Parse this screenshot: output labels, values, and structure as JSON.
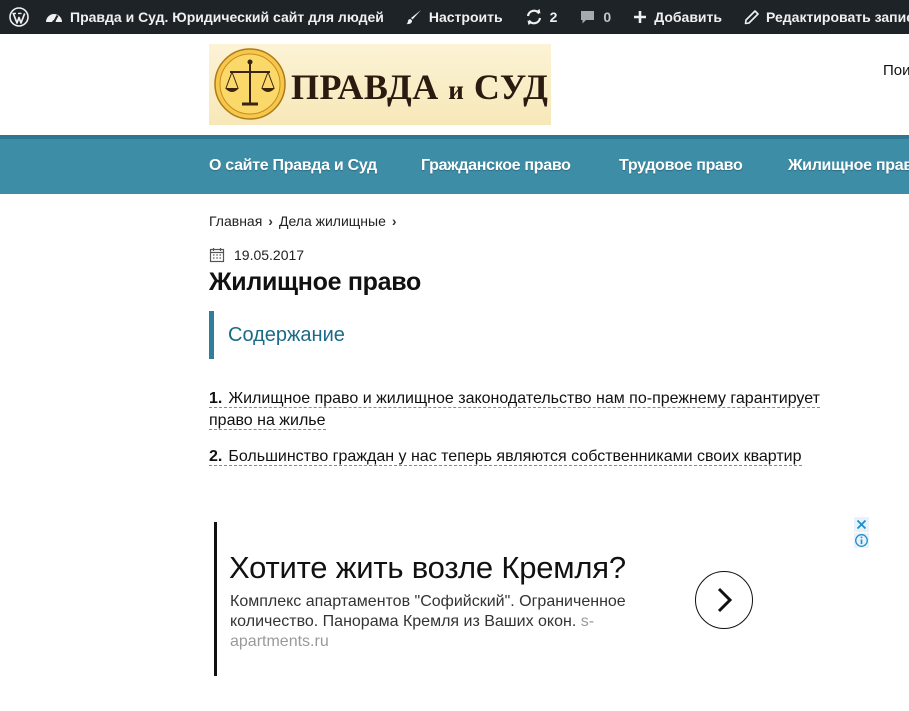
{
  "adminbar": {
    "site_name": "Правда и Суд. Юридический сайт для людей",
    "customize": "Настроить",
    "updates_count": "2",
    "comments_count": "0",
    "add_new": "Добавить",
    "edit_post": "Редактировать запись"
  },
  "header": {
    "logo_word1": "ПРАВДА",
    "logo_word2": "и",
    "logo_word3": "СУД",
    "right_text": "Пои"
  },
  "nav": {
    "items": [
      {
        "label": "О сайте Правда и Суд"
      },
      {
        "label": "Гражданское право"
      },
      {
        "label": "Трудовое право"
      },
      {
        "label": "Жилищное право"
      }
    ]
  },
  "breadcrumb": {
    "home": "Главная",
    "category": "Дела жилищные"
  },
  "post": {
    "date": "19.05.2017",
    "title": "Жилищное право"
  },
  "toc": {
    "title": "Содержание",
    "items": [
      {
        "num": "1.",
        "text": "Жилищное право и жилищное законодательство нам по-прежнему гарантирует право на жилье"
      },
      {
        "num": "2.",
        "text": "Большинство граждан у нас теперь являются собственниками своих квартир"
      }
    ]
  },
  "ad": {
    "headline": "Хотите жить возле Кремля?",
    "body": "Комплекс апартаментов \"Софийский\". Ограниченное количество. Панорама Кремля из Ваших окон.",
    "domain": "s-apartments.ru"
  },
  "colors": {
    "adminbar_bg": "#1d2327",
    "nav_bg": "#3d8da7",
    "accent": "#2d7f9b",
    "toc_title": "#1c6a86"
  }
}
